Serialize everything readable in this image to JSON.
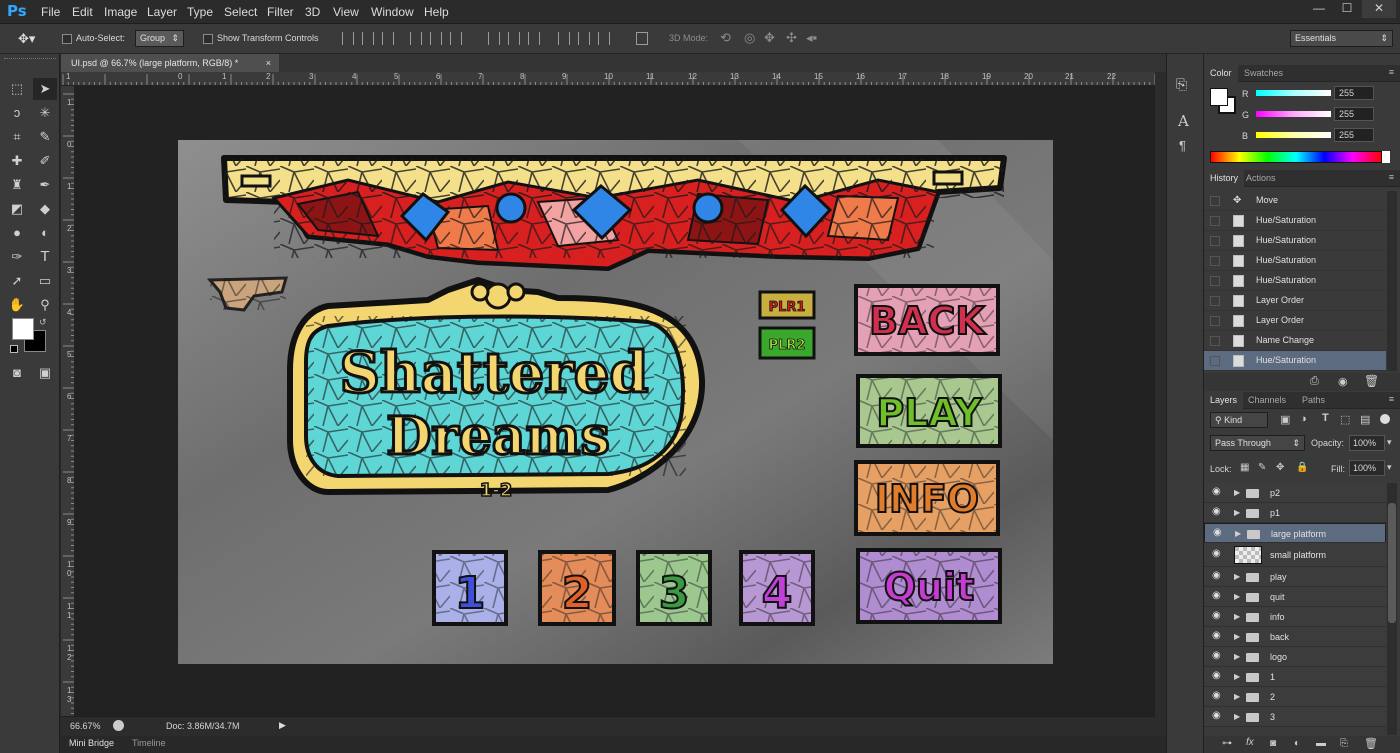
{
  "app": {
    "logo": "Ps"
  },
  "menubar": {
    "items": [
      "File",
      "Edit",
      "Image",
      "Layer",
      "Type",
      "Select",
      "Filter",
      "3D",
      "View",
      "Window",
      "Help"
    ],
    "window_controls": {
      "minimize": "—",
      "maximize": "☐",
      "close": "✕"
    }
  },
  "options": {
    "auto_select_label": "Auto-Select:",
    "auto_select_value": "Group",
    "show_transform_label": "Show Transform Controls",
    "mode_3d_label": "3D Mode:",
    "workspace_value": "Essentials"
  },
  "document": {
    "tab_title": "UI.psd @ 66.7% (large platform, RGB/8) *",
    "close": "×",
    "ruler_h": [
      "1",
      "0",
      "1",
      "2",
      "3",
      "4",
      "5",
      "6",
      "7",
      "8",
      "9",
      "10",
      "11",
      "12",
      "13",
      "14",
      "15",
      "16",
      "17",
      "18",
      "19",
      "20",
      "21",
      "22"
    ],
    "ruler_v": [
      "1",
      "0",
      "1",
      "2",
      "3",
      "4",
      "5",
      "6",
      "7",
      "8",
      "9",
      "1 0",
      "1 1",
      "1 2",
      "1 3"
    ]
  },
  "artwork": {
    "title_line1": "Shattered",
    "title_line2": "Dreams",
    "title_sub": "1-2",
    "plr1": "PLR1",
    "plr2": "PLR2",
    "buttons": [
      "BACK",
      "PLAY",
      "INFO",
      "Quit"
    ],
    "numbers": [
      "1",
      "2",
      "3",
      "4"
    ]
  },
  "status": {
    "zoom": "66.67%",
    "doc": "Doc: 3.86M/34.7M"
  },
  "bottom_tabs": [
    "Mini Bridge",
    "Timeline"
  ],
  "color_panel": {
    "tabs": [
      "Color",
      "Swatches"
    ],
    "channels": [
      {
        "label": "R",
        "value": "255",
        "color": "#30d5e8"
      },
      {
        "label": "G",
        "value": "255",
        "color": "#e83fd0"
      },
      {
        "label": "B",
        "value": "255",
        "color": "#f2e43a"
      }
    ]
  },
  "history_panel": {
    "tabs": [
      "History",
      "Actions"
    ],
    "items": [
      "Move",
      "Hue/Saturation",
      "Hue/Saturation",
      "Hue/Saturation",
      "Hue/Saturation",
      "Layer Order",
      "Layer Order",
      "Name Change",
      "Hue/Saturation"
    ]
  },
  "layers_panel": {
    "tabs": [
      "Layers",
      "Channels",
      "Paths"
    ],
    "filter_kind": "Kind",
    "blend_mode": "Pass Through",
    "opacity_label": "Opacity:",
    "opacity_value": "100%",
    "lock_label": "Lock:",
    "fill_label": "Fill:",
    "fill_value": "100%",
    "layers": [
      "p2",
      "p1",
      "large platform",
      "small platform",
      "play",
      "quit",
      "info",
      "back",
      "logo",
      "1",
      "2",
      "3"
    ]
  }
}
